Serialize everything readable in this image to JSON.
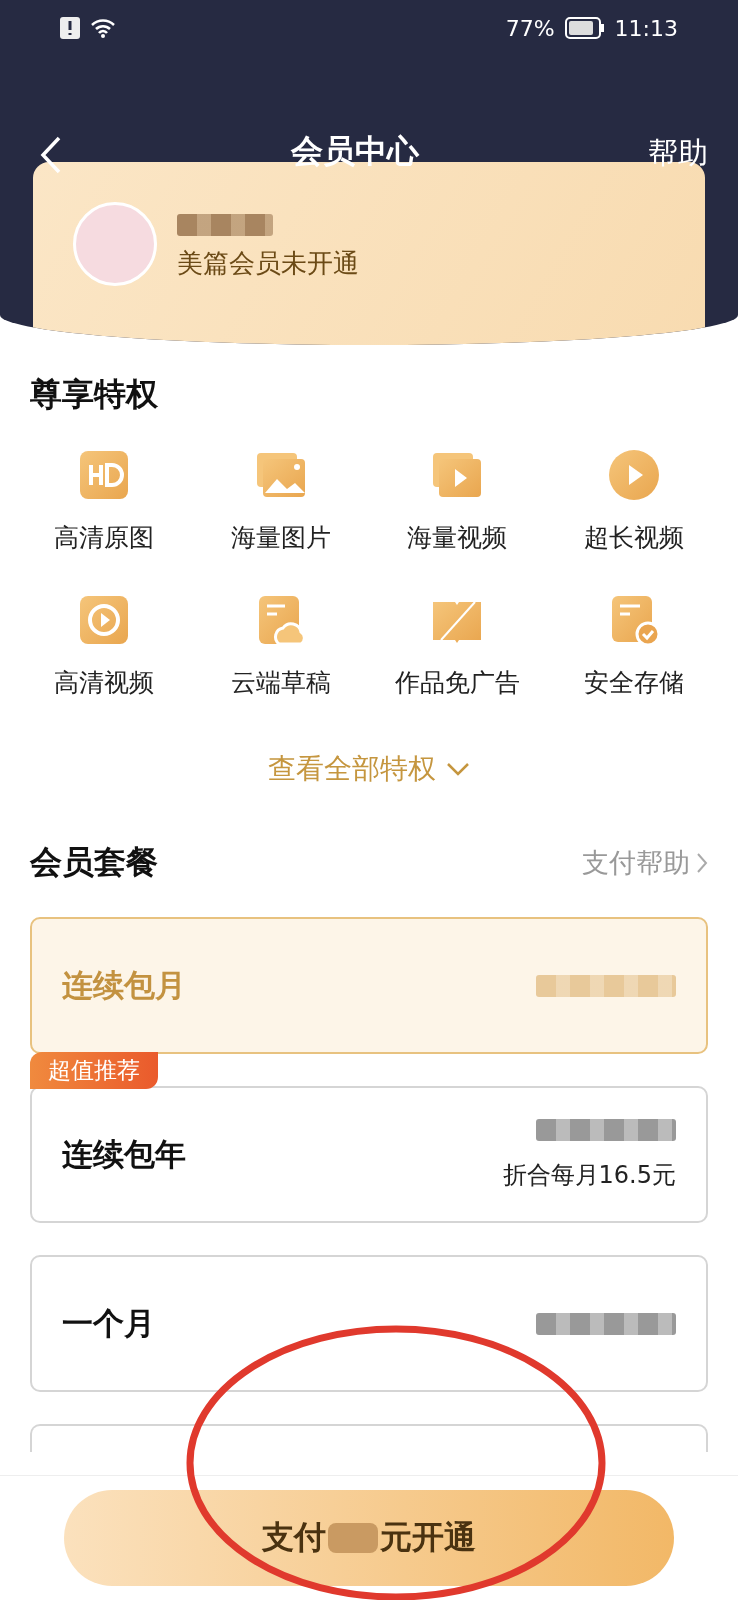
{
  "status_bar": {
    "battery": "77%",
    "time": "11:13"
  },
  "nav": {
    "title": "会员中心",
    "action": "帮助"
  },
  "profile": {
    "status": "美篇会员未开通"
  },
  "privileges": {
    "title": "尊享特权",
    "items": [
      {
        "label": "高清原图"
      },
      {
        "label": "海量图片"
      },
      {
        "label": "海量视频"
      },
      {
        "label": "超长视频"
      },
      {
        "label": "高清视频"
      },
      {
        "label": "云端草稿"
      },
      {
        "label": "作品免广告"
      },
      {
        "label": "安全存储"
      }
    ],
    "more": "查看全部特权"
  },
  "plans": {
    "title": "会员套餐",
    "help": "支付帮助",
    "items": [
      {
        "name": "连续包月",
        "selected": true
      },
      {
        "name": "连续包年",
        "selected": false,
        "badge": "超值推荐",
        "note": "折合每月16.5元"
      },
      {
        "name": "一个月",
        "selected": false
      },
      {
        "selected": false
      }
    ]
  },
  "pay": {
    "prefix": "支付",
    "suffix": "元开通"
  }
}
